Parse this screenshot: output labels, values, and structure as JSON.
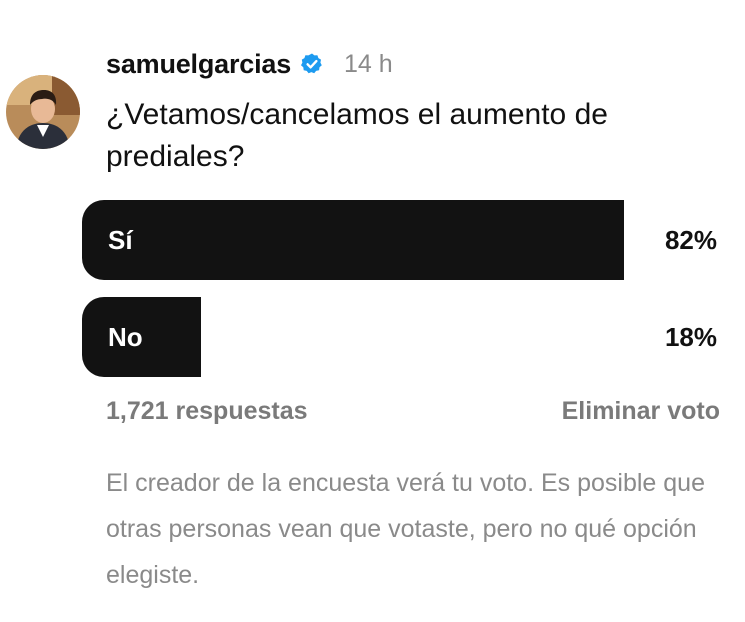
{
  "post": {
    "username": "samuelgarcias",
    "verified": true,
    "timestamp": "14 h",
    "question": "¿Vetamos/cancelamos el aumento de prediales?"
  },
  "poll": {
    "options": [
      {
        "label": "Sí",
        "percent_text": "82%",
        "percent": 82
      },
      {
        "label": "No",
        "percent_text": "18%",
        "percent": 18
      }
    ],
    "responses": "1,721 respuestas",
    "remove_vote": "Eliminar voto",
    "disclaimer": "El creador de la encuesta verá tu voto. Es posible que otras personas vean que votaste, pero no qué opción elegiste."
  },
  "colors": {
    "bar": "#121212",
    "verified": "#1d9bf0",
    "muted_text": "#7a7a7a"
  },
  "icons": {
    "verified": "verified-badge-icon",
    "avatar": "profile-avatar"
  }
}
